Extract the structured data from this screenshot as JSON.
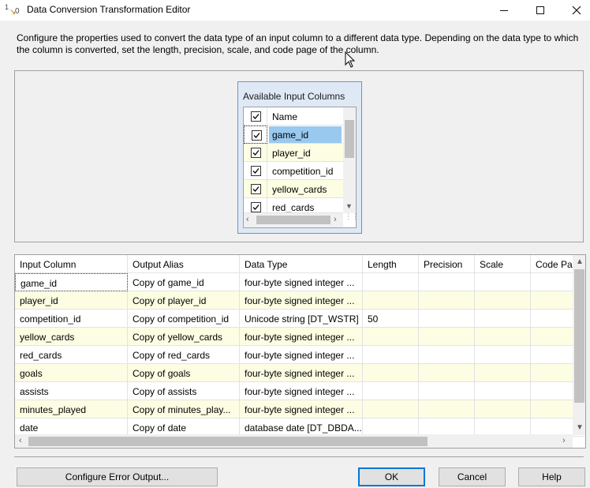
{
  "window": {
    "title": "Data Conversion Transformation Editor",
    "icon": "data-conversion-icon"
  },
  "description": "Configure the properties used to convert the data type of an input column to a different data type. Depending on the data type to which the column is converted, set the length, precision, scale, and code page of the column.",
  "available_columns": {
    "title": "Available Input Columns",
    "header": "Name",
    "items": [
      {
        "label": "game_id",
        "checked": true,
        "selected": true
      },
      {
        "label": "player_id",
        "checked": true
      },
      {
        "label": "competition_id",
        "checked": true
      },
      {
        "label": "yellow_cards",
        "checked": true
      },
      {
        "label": "red_cards",
        "checked": true
      }
    ]
  },
  "grid": {
    "headers": [
      "Input Column",
      "Output Alias",
      "Data Type",
      "Length",
      "Precision",
      "Scale",
      "Code Pag"
    ],
    "rows": [
      {
        "input": "game_id",
        "alias": "Copy of game_id",
        "type": "four-byte signed integer ...",
        "length": ""
      },
      {
        "input": "player_id",
        "alias": "Copy of player_id",
        "type": "four-byte signed integer ...",
        "length": ""
      },
      {
        "input": "competition_id",
        "alias": "Copy of competition_id",
        "type": "Unicode string [DT_WSTR]",
        "length": "50"
      },
      {
        "input": "yellow_cards",
        "alias": "Copy of yellow_cards",
        "type": "four-byte signed integer ...",
        "length": ""
      },
      {
        "input": "red_cards",
        "alias": "Copy of red_cards",
        "type": "four-byte signed integer ...",
        "length": ""
      },
      {
        "input": "goals",
        "alias": "Copy of goals",
        "type": "four-byte signed integer ...",
        "length": ""
      },
      {
        "input": "assists",
        "alias": "Copy of assists",
        "type": "four-byte signed integer ...",
        "length": ""
      },
      {
        "input": "minutes_played",
        "alias": "Copy of minutes_play...",
        "type": "four-byte signed integer ...",
        "length": ""
      },
      {
        "input": "date",
        "alias": "Copy of date",
        "type": "database date [DT_DBDA...",
        "length": ""
      }
    ]
  },
  "buttons": {
    "configure_error": "Configure Error Output...",
    "ok": "OK",
    "cancel": "Cancel",
    "help": "Help"
  },
  "colors": {
    "alt_row": "#fdfde3",
    "selection": "#99c9ef",
    "accent": "#0078d7"
  }
}
